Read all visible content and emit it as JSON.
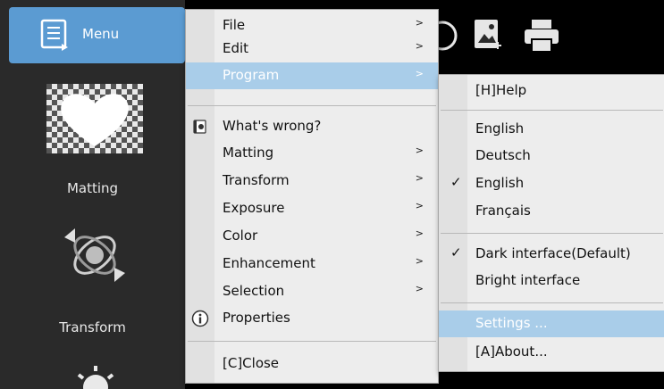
{
  "sidebar": {
    "menu_label": "Menu",
    "items": [
      {
        "label": "Matting"
      },
      {
        "label": "Transform"
      }
    ]
  },
  "main_menu": {
    "items": [
      {
        "label": "File",
        "submenu": true
      },
      {
        "label": "Edit",
        "submenu": true
      },
      {
        "label": "Program",
        "submenu": true,
        "highlighted": true
      },
      {
        "label": "What's wrong?",
        "icon": "help-book-icon"
      },
      {
        "label": "Matting",
        "submenu": true
      },
      {
        "label": "Transform",
        "submenu": true
      },
      {
        "label": "Exposure",
        "submenu": true
      },
      {
        "label": "Color",
        "submenu": true
      },
      {
        "label": "Enhancement",
        "submenu": true
      },
      {
        "label": "Selection",
        "submenu": true
      },
      {
        "label": "Properties",
        "icon": "info-icon"
      },
      {
        "label": "[C]Close"
      }
    ],
    "arrow_glyph": ">"
  },
  "program_submenu": {
    "items": [
      {
        "label": "[H]Help"
      },
      {
        "label": "English"
      },
      {
        "label": "Deutsch"
      },
      {
        "label": "English",
        "checked": true
      },
      {
        "label": "Français"
      },
      {
        "label": "Dark interface(Default)",
        "checked": true
      },
      {
        "label": "Bright interface"
      },
      {
        "label": "Settings ...",
        "highlighted": true
      },
      {
        "label": "[A]About..."
      }
    ],
    "check_glyph": "✓"
  },
  "colors": {
    "menu_button_bg": "#5b9bd2",
    "highlight_bg": "#a9cde9",
    "menu_bg": "#ededed",
    "sidebar_bg": "#2a2a2a"
  }
}
